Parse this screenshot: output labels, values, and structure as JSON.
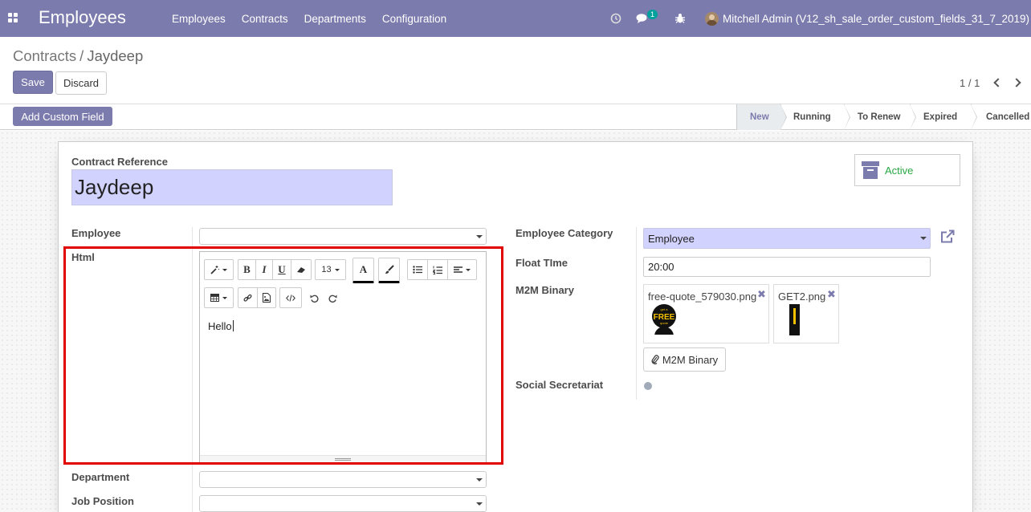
{
  "navbar": {
    "app_title": "Employees",
    "menu": [
      "Employees",
      "Contracts",
      "Departments",
      "Configuration"
    ],
    "messages_badge": "1",
    "user_name": "Mitchell Admin (V12_sh_sale_order_custom_fields_31_7_2019)",
    "icons": [
      "apps-icon",
      "clock-icon",
      "chat-icon",
      "bug-icon",
      "avatar"
    ]
  },
  "breadcrumb": {
    "parent": "Contracts",
    "separator": "/",
    "current": "Jaydeep"
  },
  "buttons": {
    "save": "Save",
    "discard": "Discard",
    "add_custom_field": "Add Custom Field",
    "m2m_binary": "M2M Binary"
  },
  "pager": {
    "value": "1 / 1"
  },
  "statusbar": {
    "stages": [
      "New",
      "Running",
      "To Renew",
      "Expired",
      "Cancelled"
    ],
    "active": "New"
  },
  "form": {
    "contract_reference_label": "Contract Reference",
    "contract_reference_value": "Jaydeep",
    "active_button": "Active",
    "employee_label": "Employee",
    "employee_value": "",
    "html_label": "Html",
    "html_value": "Hello",
    "font_size": "13",
    "department_label": "Department",
    "department_value": "",
    "job_position_label": "Job Position",
    "job_position_value": "",
    "employee_category_label": "Employee Category",
    "employee_category_value": "Employee",
    "float_time_label": "Float TIme",
    "float_time_value": "20:00",
    "m2m_binary_label": "M2M Binary",
    "attachments": [
      {
        "name": "free-quote_579030.png"
      },
      {
        "name": "GET2.png"
      }
    ],
    "social_secretariat_label": "Social Secretariat"
  },
  "colors": {
    "brand": "#7c7bad",
    "required_field_bg": "#d2d2ff",
    "active_text": "#28a745",
    "highlight_box": "#e10000"
  }
}
